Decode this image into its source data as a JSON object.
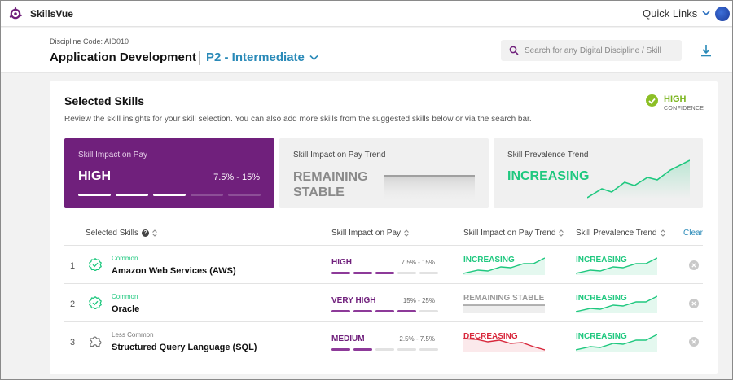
{
  "app": {
    "name": "SkillsVue"
  },
  "topbar": {
    "quick_links": "Quick Links"
  },
  "header": {
    "discipline_code": "Discipline Code: AID010",
    "title": "Application Development",
    "level": "P2 - Intermediate",
    "search_placeholder": "Search for any Digital Discipline / Skill"
  },
  "card": {
    "title": "Selected Skills",
    "description": "Review the skill insights for your skill selection. You can also add more skills from the suggested skills below or via the search bar.",
    "confidence": {
      "level": "HIGH",
      "label": "CONFIDENCE"
    }
  },
  "tiles": [
    {
      "label": "Skill Impact on Pay",
      "value": "HIGH",
      "range": "7.5% - 15%",
      "level_of_5": 3
    },
    {
      "label": "Skill Impact on Pay Trend",
      "value": "REMAINING STABLE"
    },
    {
      "label": "Skill Prevalence Trend",
      "value": "INCREASING"
    }
  ],
  "table": {
    "headers": {
      "skills": "Selected Skills",
      "impact": "Skill Impact on Pay",
      "pay_trend": "Skill Impact on Pay Trend",
      "prevalence": "Skill Prevalence Trend",
      "clear": "Clear"
    },
    "rows": [
      {
        "num": "1",
        "tag": "Common",
        "name": "Amazon Web Services (AWS)",
        "impact": "HIGH",
        "range": "7.5% - 15%",
        "level_of_5": 3,
        "pay_trend": "INCREASING",
        "prevalence": "INCREASING"
      },
      {
        "num": "2",
        "tag": "Common",
        "name": "Oracle",
        "impact": "VERY HIGH",
        "range": "15% - 25%",
        "level_of_5": 4,
        "pay_trend": "REMAINING STABLE",
        "prevalence": "INCREASING"
      },
      {
        "num": "3",
        "tag": "Less Common",
        "name": "Structured Query Language (SQL)",
        "impact": "MEDIUM",
        "range": "2.5% - 7.5%",
        "level_of_5": 2,
        "pay_trend": "DECREASING",
        "prevalence": "INCREASING"
      }
    ]
  },
  "colors": {
    "brand_purple": "#70207c",
    "increasing": "#1fc87f",
    "decreasing": "#d8283c",
    "stable": "#9a9a9a",
    "link_blue": "#2a8ab8",
    "confidence_green": "#7ab51d"
  },
  "icons": {
    "logo": "skillsvue-logo-icon",
    "search": "search-icon",
    "download": "download-icon",
    "check": "check-badge-icon",
    "puzzle": "puzzle-icon",
    "close": "close-icon"
  }
}
